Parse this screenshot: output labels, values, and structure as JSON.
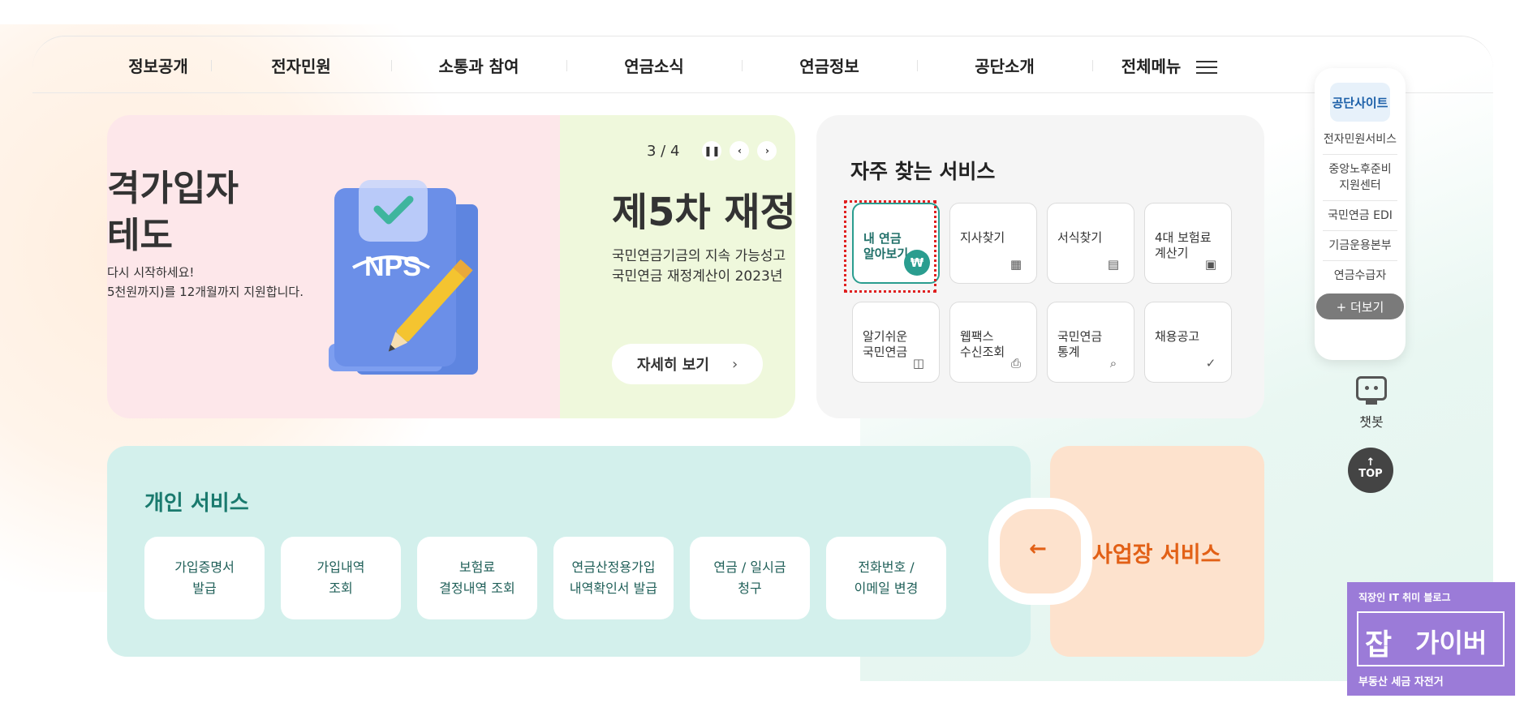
{
  "gnb": {
    "items": [
      "정보공개",
      "전자민원",
      "소통과 참여",
      "연금소식",
      "연금정보",
      "공단소개"
    ],
    "all_menu": "전체메뉴"
  },
  "banner": {
    "slide1": {
      "title": "격가입자\n테도",
      "desc": "다시 시작하세요!\n 5천원까지)를 12개월까지 지원합니다.",
      "logo_text": "NPS"
    },
    "pager": {
      "current": "3",
      "total": "4",
      "text": "3 / 4"
    },
    "slide2": {
      "title": "제5차 재정",
      "desc": "국민연금기금의 지속 가능성고\n국민연금 재정계산이 2023년",
      "button": "자세히 보기"
    }
  },
  "favorites": {
    "title": "자주 찾는 서비스",
    "items": [
      {
        "label": "내 연금\n알아보기",
        "icon": "document-won-icon"
      },
      {
        "label": "지사찾기",
        "icon": "building-icon"
      },
      {
        "label": "서식찾기",
        "icon": "clipboard-icon"
      },
      {
        "label": "4대 보험료\n계산기",
        "icon": "calculator-icon"
      },
      {
        "label": "알기쉬운\n국민연금",
        "icon": "document-icon"
      },
      {
        "label": "웹팩스\n수신조회",
        "icon": "printer-icon"
      },
      {
        "label": "국민연금\n통계",
        "icon": "document-search-icon"
      },
      {
        "label": "채용공고",
        "icon": "person-check-icon"
      }
    ]
  },
  "personal": {
    "title": "개인 서비스",
    "items": [
      "가입증명서\n발급",
      "가입내역\n조회",
      "보험료\n결정내역 조회",
      "연금산정용가입\n내역확인서 발급",
      "연금 / 일시금\n청구",
      "전화번호 /\n이메일 변경"
    ]
  },
  "business": {
    "arrow": "←",
    "title": "사업장 서비스"
  },
  "quick": {
    "head": "공단사이트",
    "items": [
      "전자민원서비스",
      "중앙노후준비\n지원센터",
      "국민연금 EDI",
      "기금운용본부",
      "연금수급자"
    ],
    "more": "+ 더보기"
  },
  "chatbot": {
    "label": "챗봇"
  },
  "top": {
    "arrow": "↑",
    "label": "TOP"
  },
  "watermark": {
    "top": "직장인 IT 취미 블로그",
    "big": "잡",
    "mid": "가이버",
    "bottom": "부동산 세금 자전거"
  }
}
